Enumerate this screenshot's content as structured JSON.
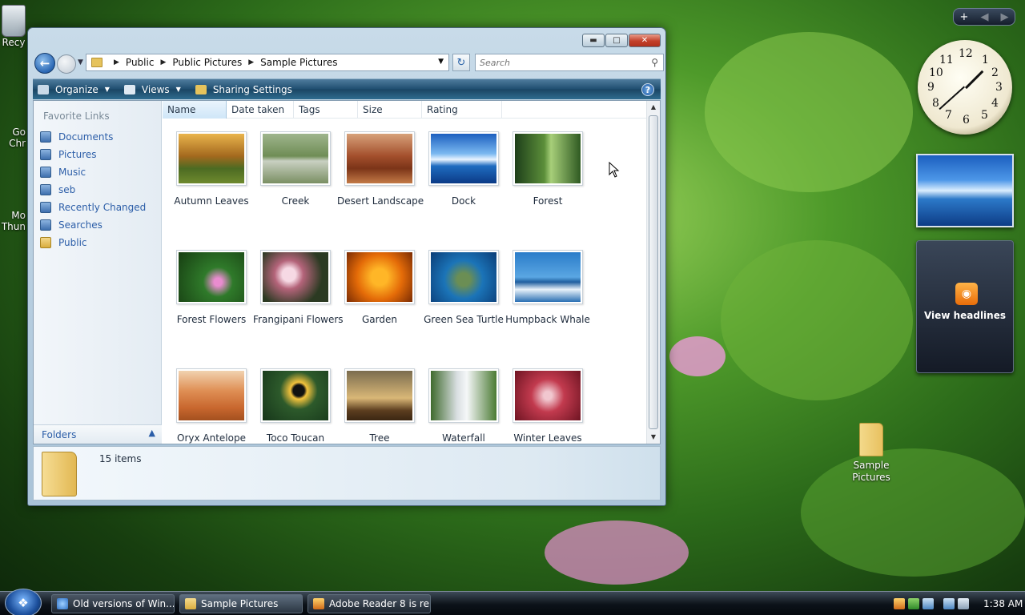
{
  "desktop": {
    "recycle_label": "Recy",
    "chrome_label_1": "Go",
    "chrome_label_2": "Chr",
    "moz_label_1": "Mo",
    "moz_label_2": "Thun",
    "folder_label_1": "Sample",
    "folder_label_2": "Pictures"
  },
  "window": {
    "breadcrumbs": [
      "Public",
      "Public Pictures",
      "Sample Pictures"
    ],
    "search_placeholder": "Search",
    "commands": {
      "organize": "Organize",
      "views": "Views",
      "sharing": "Sharing Settings"
    },
    "favorite_links_heading": "Favorite Links",
    "links": [
      "Documents",
      "Pictures",
      "Music",
      "seb",
      "Recently Changed",
      "Searches",
      "Public"
    ],
    "folders_label": "Folders",
    "columns": [
      "Name",
      "Date taken",
      "Tags",
      "Size",
      "Rating"
    ],
    "items": [
      "Autumn Leaves",
      "Creek",
      "Desert Landscape",
      "Dock",
      "Forest",
      "Forest Flowers",
      "Frangipani Flowers",
      "Garden",
      "Green Sea Turtle",
      "Humpback Whale",
      "Oryx Antelope",
      "Toco Toucan",
      "Tree",
      "Waterfall",
      "Winter Leaves"
    ],
    "item_count": "15 items"
  },
  "gadgets": {
    "clock_numbers": [
      "12",
      "1",
      "2",
      "3",
      "4",
      "5",
      "6",
      "7",
      "8",
      "9",
      "10",
      "11"
    ],
    "feed_label": "View headlines"
  },
  "taskbar": {
    "tasks": [
      "Old versions of Win...",
      "Sample Pictures",
      "Adobe Reader 8 is re..."
    ],
    "time": "1:38 AM"
  },
  "colors": {
    "accent": "#2c5ea8",
    "command_bar": "#1e4d6f",
    "close": "#c3402b"
  }
}
